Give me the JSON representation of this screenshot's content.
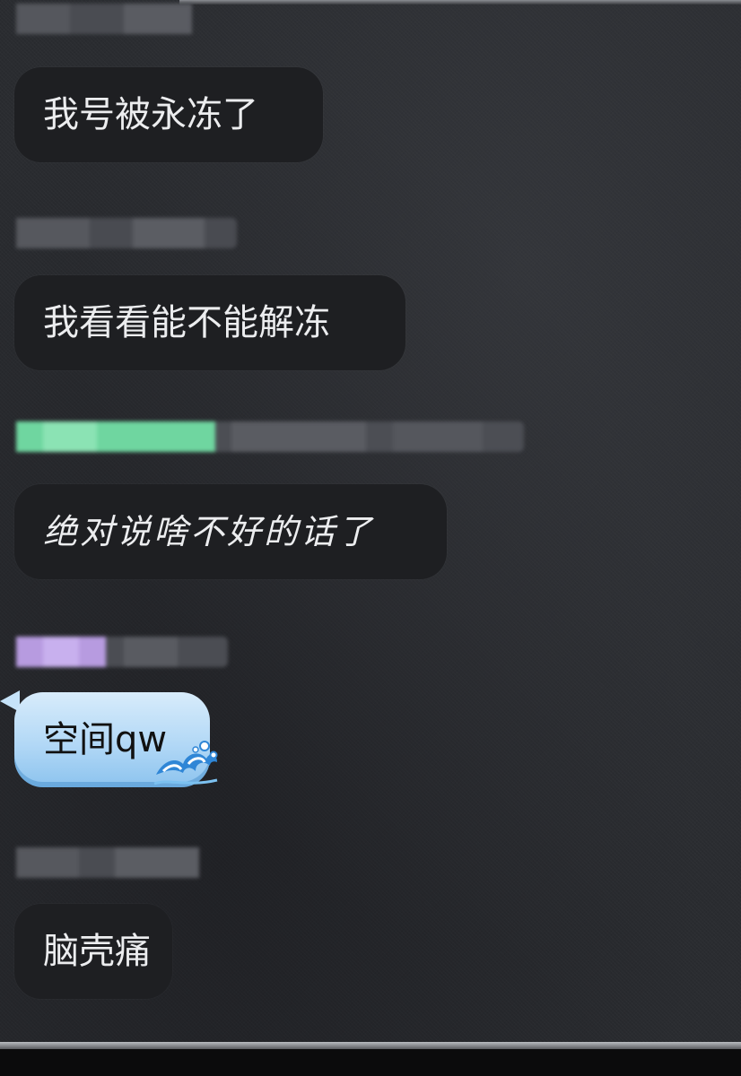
{
  "messages": [
    {
      "text": "我号被永冻了"
    },
    {
      "text": "我看看能不能解冻"
    },
    {
      "text": "绝对说啥不好的话了"
    },
    {
      "text": "空间qw"
    },
    {
      "text": "脑壳痛"
    }
  ],
  "icons": {
    "bubble_decoration": "wave-icon"
  },
  "colors": {
    "background": "#2a2c30",
    "bubble": "#1e1f22",
    "bubble_text": "#ecedef",
    "themed_bubble_light": "#d8ecfb",
    "themed_bubble_dark": "#8cc3ee",
    "name_tag_green": "#6fd6a0",
    "name_tag_purple": "#b79be0"
  }
}
